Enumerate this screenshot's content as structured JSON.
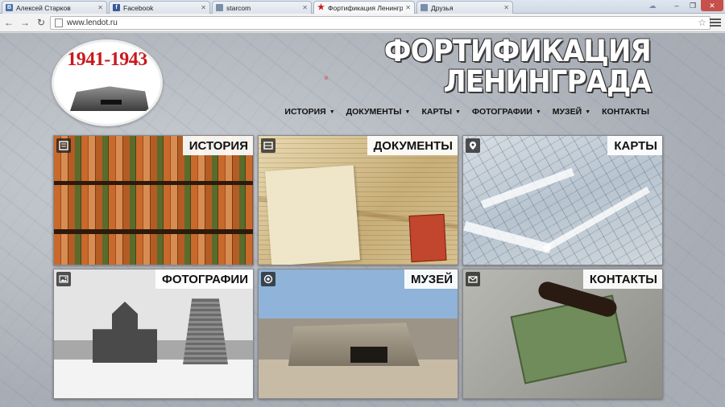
{
  "browser": {
    "tabs": [
      {
        "title": "Алексей Старков",
        "fav_color": "#4a6fa5",
        "fav_glyph": "В",
        "active": false
      },
      {
        "title": "Facebook",
        "fav_color": "#3b5998",
        "fav_glyph": "f",
        "active": false
      },
      {
        "title": "starcom",
        "fav_color": "#7a8ea8",
        "fav_glyph": "",
        "active": false
      },
      {
        "title": "Фортификация Ленинград",
        "fav_color": "#c8191c",
        "fav_glyph": "★",
        "active": true
      },
      {
        "title": "Друзья",
        "fav_color": "#7a8ea8",
        "fav_glyph": "",
        "active": false
      }
    ],
    "url": "www.lendot.ru"
  },
  "site": {
    "logo_years": "1941-1943",
    "title_line1": "ФОРТИФИКАЦИЯ",
    "title_line2": "ЛЕНИНГРАДА",
    "nav": [
      {
        "label": "ИСТОРИЯ",
        "has_menu": true
      },
      {
        "label": "ДОКУМЕНТЫ",
        "has_menu": true
      },
      {
        "label": "КАРТЫ",
        "has_menu": true
      },
      {
        "label": "ФОТОГРАФИИ",
        "has_menu": true
      },
      {
        "label": "МУЗЕЙ",
        "has_menu": true
      },
      {
        "label": "КОНТАКТЫ",
        "has_menu": false
      }
    ]
  },
  "tiles": [
    {
      "label": "ИСТОРИЯ",
      "icon": "book-icon"
    },
    {
      "label": "ДОКУМЕНТЫ",
      "icon": "inbox-icon"
    },
    {
      "label": "КАРТЫ",
      "icon": "map-marker-icon"
    },
    {
      "label": "ФОТОГРАФИИ",
      "icon": "image-icon"
    },
    {
      "label": "МУЗЕЙ",
      "icon": "target-icon"
    },
    {
      "label": "КОНТАКТЫ",
      "icon": "envelope-icon"
    }
  ]
}
